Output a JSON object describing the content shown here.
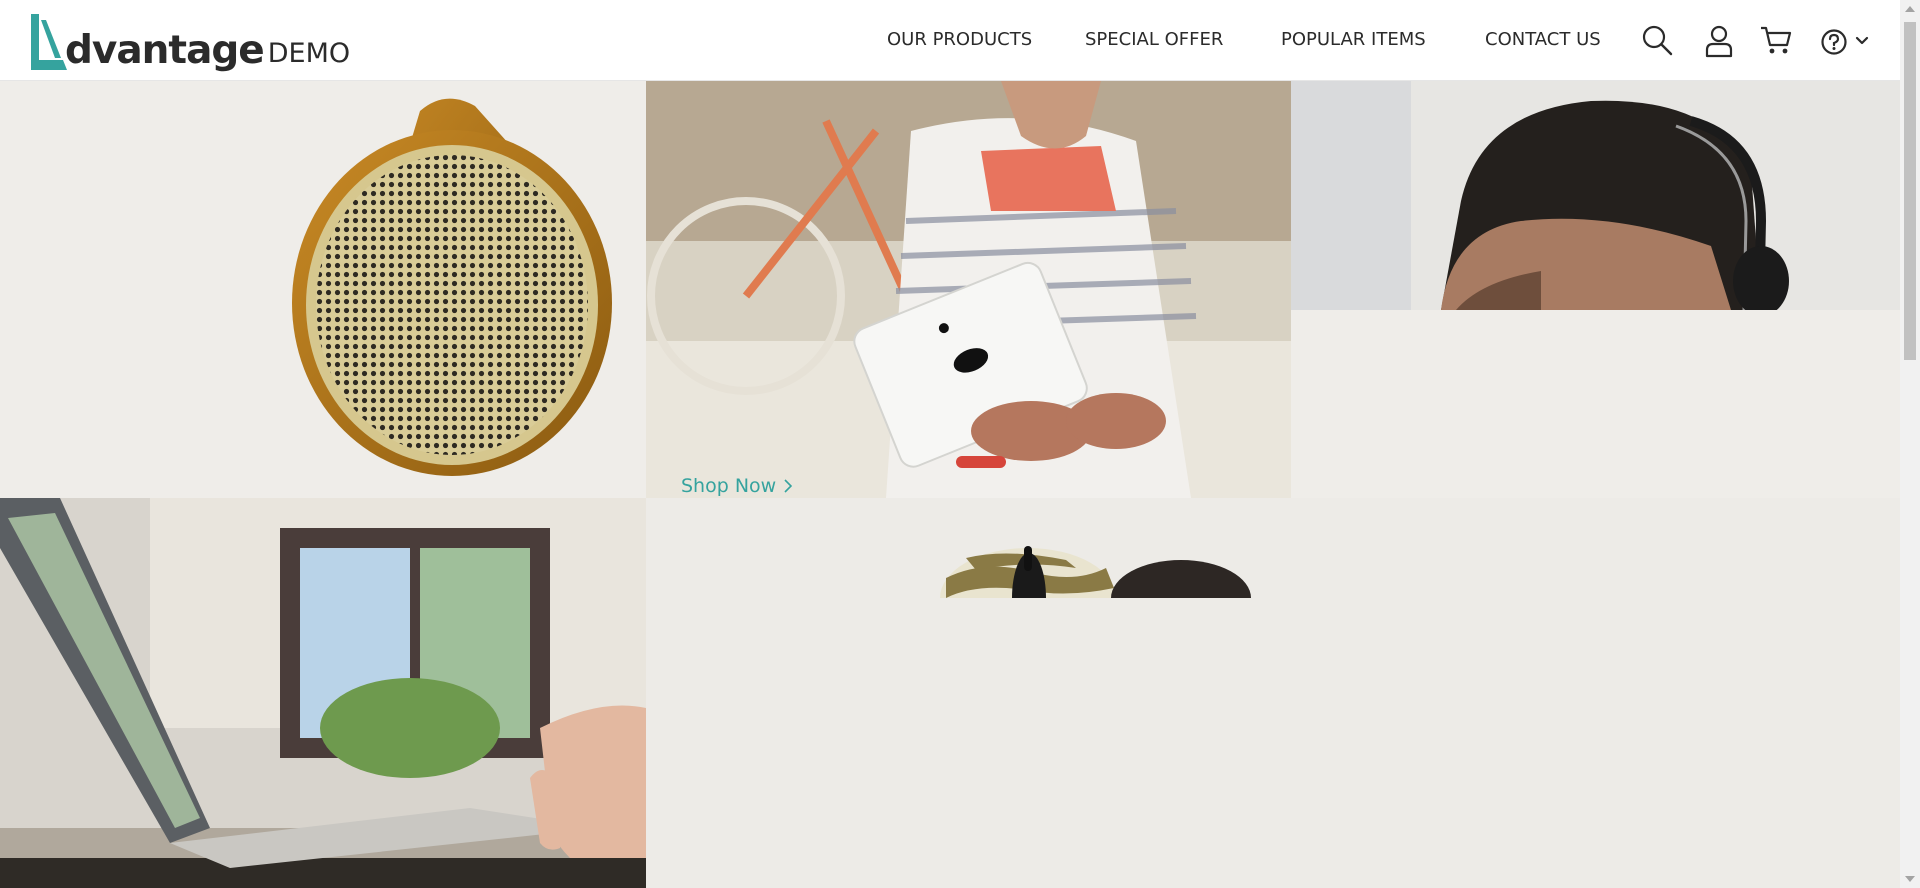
{
  "logo": {
    "word": "dvantage",
    "suffix": "DEMO"
  },
  "nav": [
    {
      "label": "OUR PRODUCTS"
    },
    {
      "label": "SPECIAL OFFER"
    },
    {
      "label": "POPULAR ITEMS"
    },
    {
      "label": "CONTACT US"
    }
  ],
  "icons": [
    "search-icon",
    "user-icon",
    "cart-icon",
    "help-icon",
    "chevron-down-icon"
  ],
  "promo": {
    "shop_now_label": "Shop Now"
  },
  "colors": {
    "accent": "#35a39e",
    "text": "#2b2b2b",
    "panel_bg": "#efede9"
  }
}
